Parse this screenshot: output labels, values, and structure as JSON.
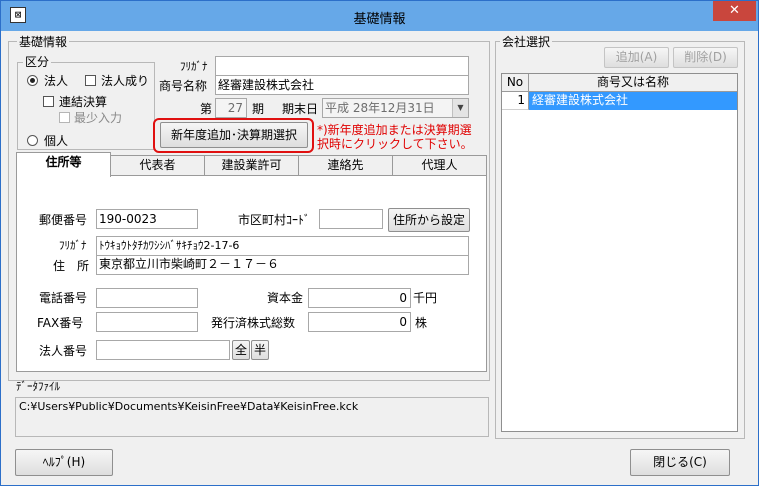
{
  "window": {
    "title": "基礎情報",
    "icon": "app-icon",
    "close_glyph": "✕"
  },
  "basic": {
    "group_title": "基礎情報",
    "kubun": {
      "title": "区分",
      "hojin": "法人",
      "hojin_nari": "法人成り",
      "renketsu": "連結決算",
      "saisho": "最少入力",
      "kojin": "個人"
    },
    "furigana_label": "ﾌﾘｶﾞﾅ",
    "furigana_value": "",
    "shogo_label": "商号名称",
    "shogo_value": "経審建設株式会社",
    "dai": "第",
    "period_value": "27",
    "ki": "期",
    "kimatsu_label": "期末日",
    "kimatsu_value": "平成 28年12月31日",
    "new_button": "新年度追加･決算期選択",
    "note": "*)新年度追加または決算期選択時にクリックして下さい。"
  },
  "tabs": [
    {
      "label": "住所等",
      "active": true
    },
    {
      "label": "代表者"
    },
    {
      "label": "建設業許可"
    },
    {
      "label": "連絡先"
    },
    {
      "label": "代理人"
    }
  ],
  "address": {
    "postal_label": "郵便番号",
    "postal_value": "190-0023",
    "city_code_label": "市区町村ｺｰﾄﾞ",
    "city_code_value": "",
    "from_address_button": "住所から設定",
    "furigana_label": "ﾌﾘｶﾞﾅ",
    "furigana_value": "ﾄｳｷｮｳﾄﾀﾁｶﾜｼｼﾊﾞｻｷﾁｮｳ2-17-6",
    "address_label": "住　所",
    "address_value": "東京都立川市柴崎町２－１７－６",
    "phone_label": "電話番号",
    "phone_value": "",
    "capital_label": "資本金",
    "capital_value": "0",
    "capital_unit": "千円",
    "fax_label": "FAX番号",
    "fax_value": "",
    "shares_label": "発行済株式総数",
    "shares_value": "0",
    "shares_unit": "株",
    "corp_no_label": "法人番号",
    "corp_no_value": "",
    "zen": "全",
    "han": "半"
  },
  "data_file": {
    "label": "ﾃﾞｰﾀﾌｧｲﾙ",
    "path": "C:¥Users¥Public¥Documents¥KeisinFree¥Data¥KeisinFree.kck"
  },
  "company": {
    "group_title": "会社選択",
    "add_button": "追加(A)",
    "delete_button": "削除(D)",
    "columns": [
      "No",
      "商号又は名称"
    ],
    "rows": [
      {
        "no": "1",
        "name": "経審建設株式会社"
      }
    ]
  },
  "footer": {
    "help_button": "ﾍﾙﾌﾟ(H)",
    "close_button": "閉じる(C)"
  }
}
